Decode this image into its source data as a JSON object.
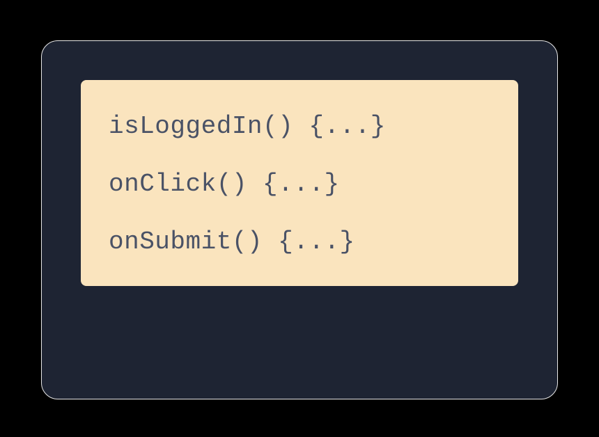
{
  "code": {
    "lines": [
      "isLoggedIn() {...}",
      "onClick() {...}",
      "onSubmit() {...}"
    ]
  }
}
